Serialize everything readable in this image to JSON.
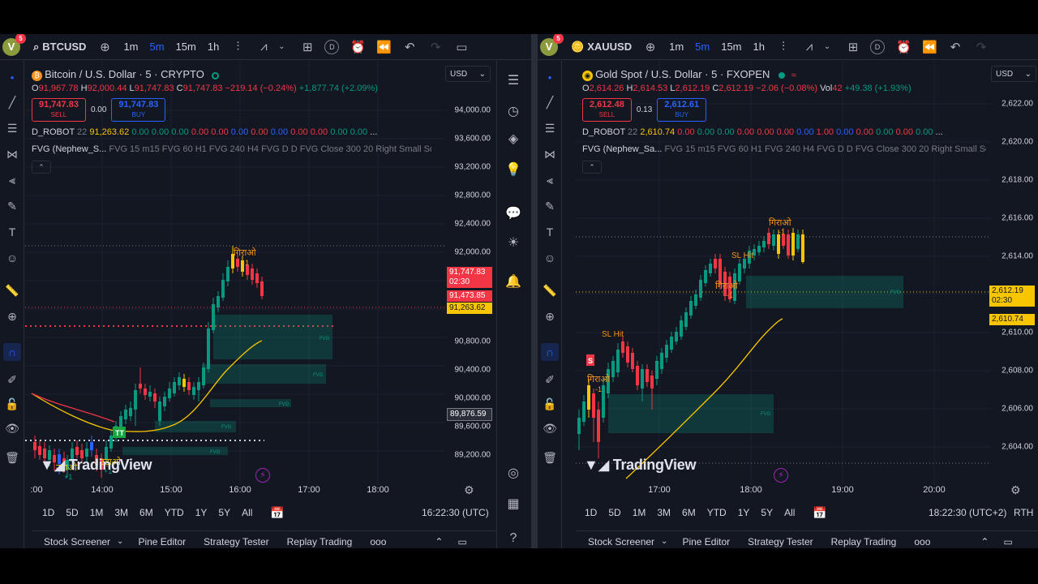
{
  "left": {
    "avatar_letter": "V",
    "badge_count": "5",
    "symbol": "BTCUSD",
    "intervals": [
      "1m",
      "5m",
      "15m",
      "1h"
    ],
    "active_interval": "5m",
    "title": "Bitcoin / U.S. Dollar · 5 · CRYPTO",
    "ohlc": {
      "o_label": "O",
      "o": "91,967.78",
      "h_label": "H",
      "h": "92,000.44",
      "l_label": "L",
      "l": "91,747.83",
      "c_label": "C",
      "c": "91,747.83",
      "chg": "−219.14 (−0.24%)",
      "extra": "+1,877.74 (+2.09%)"
    },
    "sell": {
      "price": "91,747.83",
      "label": "SELL"
    },
    "spread": "0.00",
    "buy": {
      "price": "91,747.83",
      "label": "BUY"
    },
    "robot": {
      "name": "D_ROBOT",
      "period": "22",
      "value": "91,263.62",
      "zeros": [
        "0.00",
        "0.00",
        "0.00",
        "0.00",
        "0.00",
        "0.00",
        "0.00",
        "0.00",
        "0.00",
        "0.00",
        "0.00",
        "0.00"
      ],
      "more": "..."
    },
    "fvg_line": {
      "name": "FVG (Nephew_S...",
      "params": "FVG 15 m15 FVG 60 H1 FVG 240 H4 FVG D D FVG Close 300 20 Right Small So..."
    },
    "currency": "USD",
    "price_labels": [
      "94,000.00",
      "93,600.00",
      "93,200.00",
      "92,800.00",
      "92,400.00",
      "92,000.00",
      "90,800.00",
      "90,400.00",
      "90,000.00",
      "89,600.00",
      "89,200.00"
    ],
    "tags": [
      {
        "text": "91,747.83",
        "color": "#f23645"
      },
      {
        "text": "02:30",
        "color": "#f23645"
      },
      {
        "text": "91,473.85",
        "color": "#f23645"
      },
      {
        "text": "91,263.62",
        "color": "#f7c600"
      },
      {
        "text": "89,876.59",
        "color": "#2a2e39"
      }
    ],
    "time_labels": [
      ":00",
      "14:00",
      "15:00",
      "16:00",
      "17:00",
      "18:00"
    ],
    "fvg_label": "FVG",
    "annotations": {
      "giraao": "गिराओ",
      "minus1": "-1",
      "udhao1": "उड़ाओ",
      "plus1": "+1",
      "udhao2": "उड़ाओ",
      "plus1b": "+1",
      "tt": "TT"
    },
    "logo": "TradingView",
    "ranges": [
      "1D",
      "5D",
      "1M",
      "3M",
      "6M",
      "YTD",
      "1Y",
      "5Y",
      "All"
    ],
    "clock": "16:22:30 (UTC)",
    "panels": [
      "Stock Screener",
      "Pine Editor",
      "Strategy Tester",
      "Replay Trading",
      "ooo"
    ]
  },
  "right": {
    "avatar_letter": "V",
    "badge_count": "5",
    "symbol": "XAUUSD",
    "intervals": [
      "1m",
      "5m",
      "15m",
      "1h"
    ],
    "active_interval": "5m",
    "title": "Gold Spot / U.S. Dollar · 5 · FXOPEN",
    "ohlc": {
      "o_label": "O",
      "o": "2,614.26",
      "h_label": "H",
      "h": "2,614.53",
      "l_label": "L",
      "l": "2,612.19",
      "c_label": "C",
      "c": "2,612.19",
      "chg": "−2.06 (−0.08%)",
      "vol_label": "Vol",
      "vol": "42",
      "extra": "+49.38 (+1.93%)"
    },
    "sell": {
      "price": "2,612.48",
      "label": "SELL"
    },
    "spread": "0.13",
    "buy": {
      "price": "2,612.61",
      "label": "BUY"
    },
    "robot": {
      "name": "D_ROBOT",
      "period": "22",
      "value": "2,610.74",
      "zeros": [
        "0.00",
        "0.00",
        "0.00",
        "0.00",
        "0.00",
        "0.00",
        "0.00",
        "1.00",
        "0.00",
        "0.00",
        "0.00",
        "0.00",
        "0.00"
      ],
      "more": "..."
    },
    "fvg_line": {
      "name": "FVG (Nephew_Sa...",
      "params": "FVG 15 m15 FVG 60 H1 FVG 240 H4 FVG D D FVG Close 300 20 Right Small Sol..."
    },
    "currency": "USD",
    "price_labels": [
      "2,622.00",
      "2,620.00",
      "2,618.00",
      "2,616.00",
      "2,614.00",
      "2,610.00",
      "2,608.00",
      "2,606.00",
      "2,604.00"
    ],
    "tags": [
      {
        "text": "2,612.19",
        "color": "#f7c600"
      },
      {
        "text": "02:30",
        "color": "#f7c600"
      },
      {
        "text": "2,610.74",
        "color": "#f7c600"
      }
    ],
    "time_labels": [
      "17:00",
      "18:00",
      "19:00",
      "20:00"
    ],
    "fvg_label": "FVG",
    "annotations": {
      "giraao1": "गिराओ",
      "minus1a": "-1",
      "slhit1": "SL Hit",
      "giraao2": "गिराओ",
      "minus1b": "-1",
      "giraao3": "गिराओ",
      "minus1c": "-1",
      "slhit2": "SL Hit",
      "s": "S"
    },
    "logo": "TradingView",
    "ranges": [
      "1D",
      "5D",
      "1M",
      "3M",
      "6M",
      "YTD",
      "1Y",
      "5Y",
      "All"
    ],
    "clock": "18:22:30 (UTC+2)",
    "rth": "RTH",
    "panels": [
      "Stock Screener",
      "Pine Editor",
      "Strategy Tester",
      "Replay Trading",
      "ooo"
    ]
  }
}
